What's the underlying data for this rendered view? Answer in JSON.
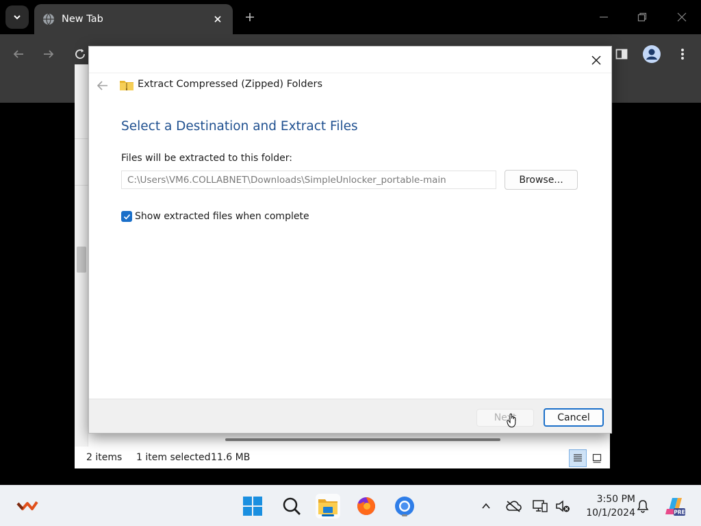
{
  "browser": {
    "tab_title": "New Tab"
  },
  "explorer": {
    "status_items": "2 items",
    "status_selected": "1 item selected",
    "status_size": "11.6 MB"
  },
  "dialog": {
    "title": "Extract Compressed (Zipped) Folders",
    "main_instruction": "Select a Destination and Extract Files",
    "folder_label": "Files will be extracted to this folder:",
    "path_value": "C:\\Users\\VM6.COLLABNET\\Downloads\\SimpleUnlocker_portable-main",
    "browse_label": "Browse...",
    "show_files_label": "Show extracted files when complete",
    "show_files_checked": true,
    "next_label": "Next",
    "cancel_label": "Cancel"
  },
  "taskbar": {
    "time": "3:50 PM",
    "date": "10/1/2024",
    "apps": [
      "winrar-icon",
      "start-icon",
      "search-icon",
      "file-explorer-icon",
      "firefox-icon",
      "chrome-icon"
    ],
    "copilot_badge": "PRE"
  },
  "colors": {
    "accent": "#1a6fc9",
    "instruction_blue": "#1e4f8f",
    "chrome_dark": "#3a3a3a"
  }
}
